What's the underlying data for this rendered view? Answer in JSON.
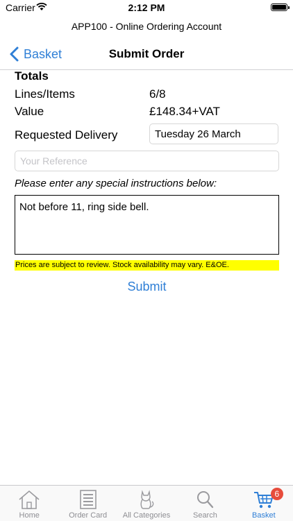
{
  "status": {
    "carrier": "Carrier",
    "time": "2:12 PM"
  },
  "app_title": "APP100 - Online Ordering Account",
  "nav": {
    "back_label": "Basket",
    "title": "Submit Order"
  },
  "totals": {
    "heading": "Totals",
    "lines_label": "Lines/Items",
    "lines_value": "6/8",
    "value_label": "Value",
    "value_amount": "£148.34+VAT"
  },
  "delivery": {
    "label": "Requested Delivery",
    "value": "Tuesday 26 March"
  },
  "reference": {
    "placeholder": "Your Reference",
    "value": ""
  },
  "instructions": {
    "label": "Please enter any special instructions below:",
    "value": "Not before 11, ring side bell."
  },
  "disclaimer": "Prices are subject to review. Stock availability may vary. E&OE.",
  "submit_label": "Submit",
  "tabs": [
    {
      "label": "Home",
      "icon": "house-icon"
    },
    {
      "label": "Order Card",
      "icon": "order-card-icon"
    },
    {
      "label": "All Categories",
      "icon": "cat-icon"
    },
    {
      "label": "Search",
      "icon": "search-icon"
    },
    {
      "label": "Basket",
      "icon": "basket-icon",
      "badge": "6",
      "active": true
    }
  ],
  "colors": {
    "accent": "#2f7fd6",
    "highlight": "#ffff00",
    "badge": "#e74c3c"
  }
}
